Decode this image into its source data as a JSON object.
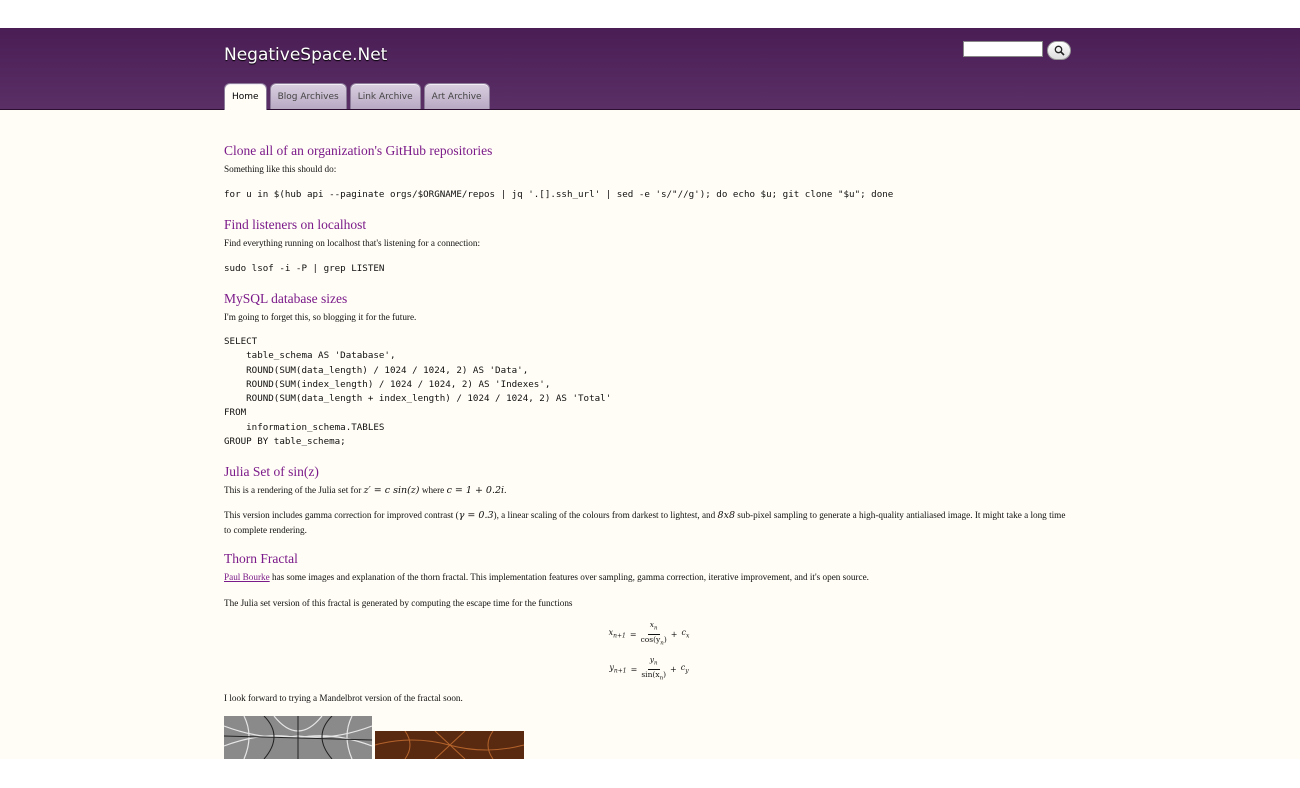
{
  "site": {
    "title": "NegativeSpace.Net",
    "search_placeholder": "",
    "search_icon": "magnifier-icon"
  },
  "tabs": [
    {
      "label": "Home",
      "active": true
    },
    {
      "label": "Blog Archives",
      "active": false
    },
    {
      "label": "Link Archive",
      "active": false
    },
    {
      "label": "Art Archive",
      "active": false
    }
  ],
  "posts": {
    "github": {
      "title": "Clone all of an organization's GitHub repositories",
      "intro": "Something like this should do:",
      "code": "for u in $(hub api --paginate orgs/$ORGNAME/repos | jq '.[].ssh_url' | sed -e 's/\"//g'); do echo $u; git clone \"$u\"; done"
    },
    "listeners": {
      "title": "Find listeners on localhost",
      "intro": "Find everything running on localhost that's listening for a connection:",
      "code": "sudo lsof -i -P | grep LISTEN"
    },
    "mysql": {
      "title": "MySQL database sizes",
      "intro": "I'm going to forget this, so blogging it for the future.",
      "code": "SELECT\n    table_schema AS 'Database',\n    ROUND(SUM(data_length) / 1024 / 1024, 2) AS 'Data',\n    ROUND(SUM(index_length) / 1024 / 1024, 2) AS 'Indexes',\n    ROUND(SUM(data_length + index_length) / 1024 / 1024, 2) AS 'Total'\nFROM\n    information_schema.TABLES\nGROUP BY table_schema;"
    },
    "julia": {
      "title": "Julia Set of sin(z)",
      "intro_pre": "This is a rendering of the Julia set for ",
      "intro_math1": "z′ = c sin(z)",
      "intro_mid": " where ",
      "intro_math2": "c = 1 + 0.2i",
      "intro_post": ".",
      "p2_pre": "This version includes gamma correction for improved contrast (",
      "p2_math1": "γ = 0.3",
      "p2_mid": "), a linear scaling of the colours from darkest to lightest, and ",
      "p2_math2": "8x8",
      "p2_post": " sub-pixel sampling to generate a high-quality antialiased image. It might take a long time to complete rendering."
    },
    "thorn": {
      "title": "Thorn Fractal",
      "link": "Paul Bourke",
      "intro_rest": " has some images and explanation of the thorn fractal. This implementation features over sampling, gamma correction, iterative improvement, and it's open source.",
      "p2": "The Julia set version of this fractal is generated by computing the escape time for the functions",
      "eq1": {
        "lhs": "x",
        "lhs_sub": "n+1",
        "num": "x",
        "num_sub": "n",
        "den": "cos(y",
        "den_sub": "n",
        "den_end": ")",
        "c": "c",
        "c_sub": "x"
      },
      "eq2": {
        "lhs": "y",
        "lhs_sub": "n+1",
        "num": "y",
        "num_sub": "n",
        "den": "sin(x",
        "den_sub": "n",
        "den_end": ")",
        "c": "c",
        "c_sub": "y"
      },
      "p3": "I look forward to trying a Mandelbrot version of the fractal soon."
    }
  }
}
